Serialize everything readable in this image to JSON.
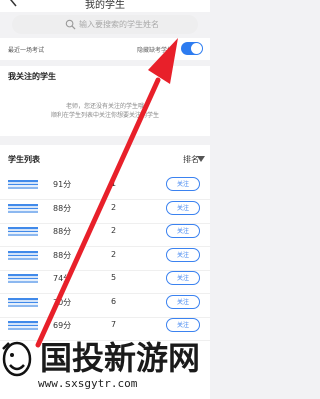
{
  "header": {
    "title": "我的学生"
  },
  "search": {
    "placeholder": "输入要搜索的学生姓名"
  },
  "filter": {
    "left_label": "最近一场考试",
    "right_label": "隐藏缺考学生",
    "toggle_on": true,
    "accent": "#2d7cf0"
  },
  "followed": {
    "title": "我关注的学生",
    "empty_line1": "老师，您还没有关注的学生哦",
    "empty_line2": "顺利在学生列表中关注你想要关注的学生"
  },
  "list": {
    "title": "学生列表",
    "sort_label": "排名",
    "follow_label": "关注",
    "rows": [
      {
        "score": "91分",
        "rank": "1"
      },
      {
        "score": "88分",
        "rank": "2"
      },
      {
        "score": "88分",
        "rank": "2"
      },
      {
        "score": "88分",
        "rank": "2"
      },
      {
        "score": "74分",
        "rank": "5"
      },
      {
        "score": "70分",
        "rank": "6"
      },
      {
        "score": "69分",
        "rank": "7"
      }
    ]
  },
  "watermark": {
    "name": "国投新游网",
    "url": "www.sxsgytr.com"
  }
}
